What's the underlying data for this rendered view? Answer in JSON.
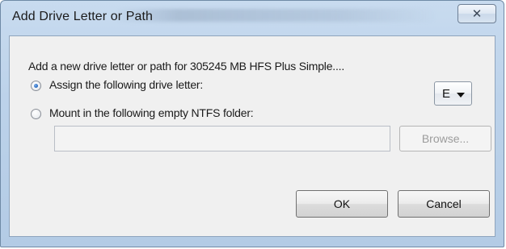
{
  "window": {
    "title": "Add Drive Letter or Path",
    "close_glyph": "✕"
  },
  "dialog": {
    "description": "Add a new drive letter or path for 305245 MB HFS Plus Simple....",
    "assign_option": {
      "label": "Assign the following drive letter:",
      "selected": true
    },
    "drive_letter": {
      "value": "E"
    },
    "mount_option": {
      "label": "Mount in the following empty NTFS folder:",
      "selected": false
    },
    "folder_path": {
      "value": "",
      "enabled": false
    },
    "browse_label": "Browse...",
    "ok_label": "OK",
    "cancel_label": "Cancel"
  },
  "icons": {
    "close": "close-icon",
    "dropdown": "chevron-down-icon"
  },
  "colors": {
    "title_bar": "#bcd2ea",
    "client_bg": "#f0f0f0",
    "radio_selected": "#2c6fc6"
  }
}
